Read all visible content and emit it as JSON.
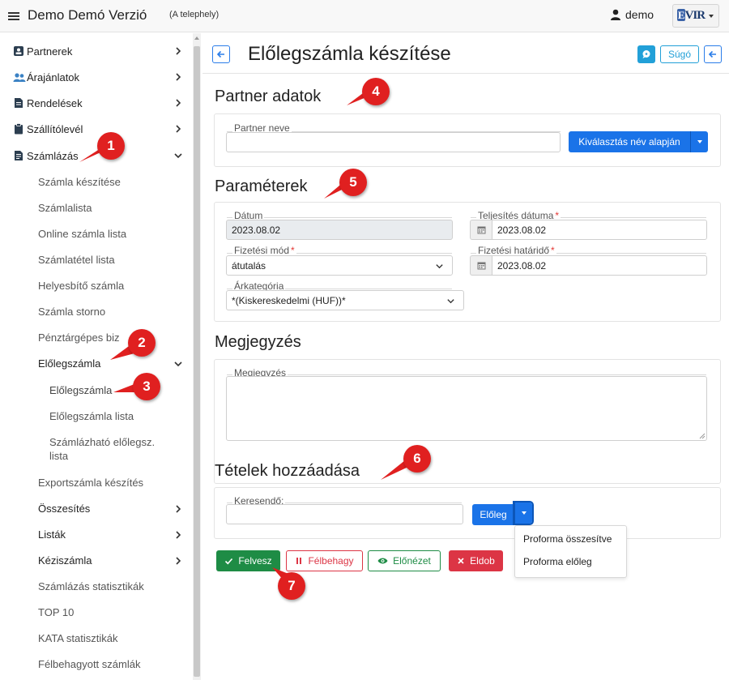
{
  "topbar": {
    "app_title": "Demo Demó Verzió",
    "site": "(A telephely)",
    "user": "demo",
    "logo_text": "VIR"
  },
  "sidebar": {
    "items": [
      {
        "label": "Partnerek",
        "icon": "contact-card-icon"
      },
      {
        "label": "Árajánlatok",
        "icon": "people-icon"
      },
      {
        "label": "Rendelések",
        "icon": "document-icon"
      },
      {
        "label": "Szállítólevél",
        "icon": "clipboard-icon"
      },
      {
        "label": "Számlázás",
        "icon": "invoice-icon"
      }
    ],
    "szamlazas_sub": [
      "Számla készítése",
      "Számlalista",
      "Online számla lista",
      "Számlatétel lista",
      "Helyesbítő számla",
      "Számla storno",
      "Pénztárgépes biz"
    ],
    "eloleg_group": "Előlegszámla",
    "eloleg_sub": [
      "Előlegszámla",
      "Előlegszámla lista",
      "Számlázható előlegsz. lista"
    ],
    "lower_sub": [
      {
        "label": "Exportszámla készítés",
        "chevron": false
      },
      {
        "label": "Összesítés",
        "chevron": true
      },
      {
        "label": "Listák",
        "chevron": true
      },
      {
        "label": "Kéziszámla",
        "chevron": true
      },
      {
        "label": "Számlázás statisztikák",
        "chevron": false
      },
      {
        "label": "TOP 10",
        "chevron": false
      },
      {
        "label": "KATA statisztikák",
        "chevron": false
      },
      {
        "label": "Félbehagyott számlák",
        "chevron": false
      }
    ]
  },
  "page": {
    "title": "Előlegszámla készítése",
    "help_label": "Súgó"
  },
  "partner": {
    "section": "Partner adatok",
    "name_label": "Partner neve",
    "name_value": "",
    "select_button": "Kiválasztás név alapján"
  },
  "params": {
    "section": "Paraméterek",
    "date_label": "Dátum",
    "date_value": "2023.08.02",
    "completion_label": "Teljesítés dátuma",
    "completion_value": "2023.08.02",
    "payment_label": "Fizetési mód",
    "payment_value": "átutalás",
    "due_label": "Fizetési határidő",
    "due_value": "2023.08.02",
    "price_cat_label": "Árkategória",
    "price_cat_value": "*(Kiskereskedelmi (HUF))*",
    "required_mark": "*"
  },
  "note": {
    "section": "Megjegyzés",
    "label": "Megjegyzés",
    "value": ""
  },
  "items": {
    "section": "Tételek hozzáadása",
    "search_label": "Keresendő:",
    "search_value": "",
    "type_button": "Előleg",
    "dropdown": [
      "Proforma összesítve",
      "Proforma előleg"
    ]
  },
  "actions": {
    "add": "Felvesz",
    "pause": "Félbehagy",
    "preview": "Előnézet",
    "discard": "Eldob"
  },
  "markers": [
    "1",
    "2",
    "3",
    "4",
    "5",
    "6",
    "7"
  ],
  "colors": {
    "primary": "#1a73e8",
    "success": "#1e8c45",
    "danger": "#dc3545",
    "info": "#22a0d8",
    "marker": "#e02020"
  }
}
